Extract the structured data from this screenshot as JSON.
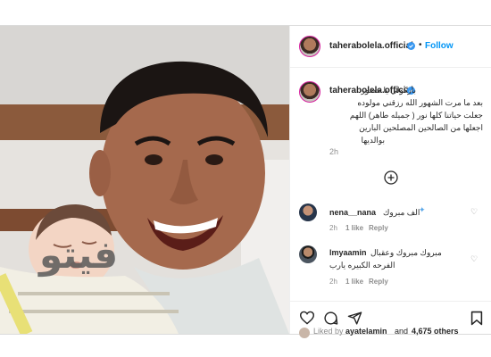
{
  "post": {
    "username": "taherabolela.official",
    "follow_dot": "•",
    "follow_label": "Follow"
  },
  "caption": {
    "username": "taherabolela.official",
    "lines": [
      "باركولي يا حضور",
      "بعد ما مرت الشهور الله رزقني مولوده",
      "جعلت حياتنا كلها نور ( جميله طاهر) اللهم",
      "اجعلها من الصالحين المصلحين البارين",
      "بوالديها"
    ],
    "time": "2h"
  },
  "comments": [
    {
      "username": "nena__nana",
      "text": "الف مبروك",
      "time": "2h",
      "likes": "1 like",
      "reply": "Reply"
    },
    {
      "username": "lmyaamin",
      "text": "مبروك مبروك وعقبال",
      "text2": "الفرحه الكبيره يارب",
      "time": "2h",
      "likes": "1 like",
      "reply": "Reply"
    }
  ],
  "likes_line": {
    "prefix": "Liked by",
    "user": "ayatelamin",
    "mid": "and",
    "count": "4,675 others"
  },
  "watermark": "فيتو",
  "colors": {
    "link": "#0095f6",
    "verified": "#3897f0",
    "text": "#262626",
    "muted": "#8e8e8e"
  }
}
